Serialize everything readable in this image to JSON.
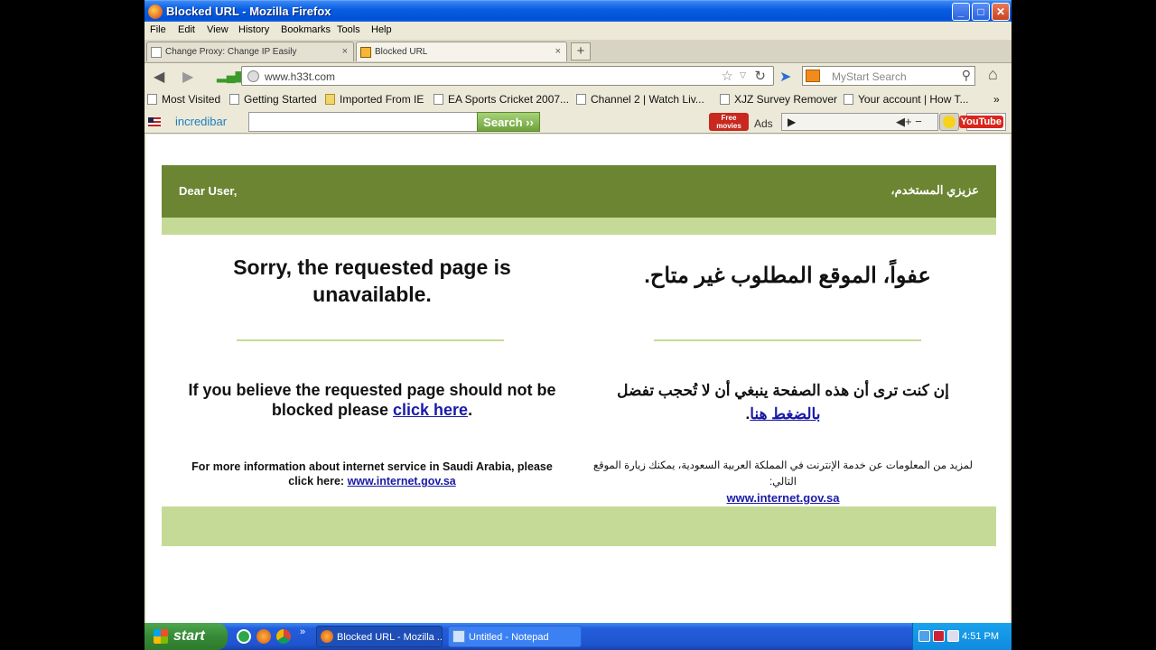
{
  "window": {
    "title": "Blocked URL - Mozilla Firefox",
    "buttons": {
      "minimize": "_",
      "maximize": "□",
      "close": "✕"
    }
  },
  "menu": [
    "File",
    "Edit",
    "View",
    "History",
    "Bookmarks",
    "Tools",
    "Help"
  ],
  "tabs": [
    {
      "label": "Change Proxy: Change IP Easily",
      "close": "×"
    },
    {
      "label": "Blocked URL",
      "close": "×"
    }
  ],
  "new_tab": "+",
  "nav": {
    "back": "◀",
    "forward": "▶",
    "url": "www.h33t.com",
    "star": "☆",
    "dropdown": "▽",
    "reload": "↻",
    "search_placeholder": "MyStart Search",
    "search_icon": "⚲",
    "home": "⌂"
  },
  "bookmarks": [
    {
      "label": "Most Visited",
      "icon": "page"
    },
    {
      "label": "Getting Started",
      "icon": "page"
    },
    {
      "label": "Imported From IE",
      "icon": "folder"
    },
    {
      "label": "EA Sports Cricket 2007...",
      "icon": "page"
    },
    {
      "label": "Channel 2 | Watch Liv...",
      "icon": "page"
    },
    {
      "label": "XJZ Survey Remover",
      "icon": "page"
    },
    {
      "label": "Your account | How T...",
      "icon": "page"
    }
  ],
  "bookmarks_more": "»",
  "incredibar": {
    "logo": "incredibar",
    "search_button": "Search ››",
    "free_movies": "Free movies",
    "ads": "Ads",
    "play": "▶",
    "youtube": "YouTube"
  },
  "page": {
    "header_en": "Dear User,",
    "header_ar": "عزيزي المستخدم،",
    "sorry_en": "Sorry, the requested page is unavailable.",
    "sorry_ar": "عفواً، الموقع المطلوب غير متاح.",
    "believe_en_prefix": "If you believe the requested page should not be blocked please",
    "believe_en_link": "click here",
    "believe_en_suffix": ".",
    "believe_ar_prefix": "إن كنت ترى أن هذه الصفحة ينبغي أن لا تُحجب تفضل",
    "believe_ar_link": "بالضغط هنا",
    "believe_ar_suffix": ".",
    "more_en": "For more information about internet service in Saudi Arabia, please click here:",
    "more_en_link": "www.internet.gov.sa",
    "more_ar": "لمزيد من المعلومات عن خدمة الإنترنت في المملكة العربية السعودية، يمكنك زيارة الموقع التالي:",
    "more_ar_link": "www.internet.gov.sa"
  },
  "taskbar": {
    "start": "start",
    "tasks": [
      {
        "label": "Blocked URL - Mozilla ...",
        "active": true
      },
      {
        "label": "Untitled - Notepad",
        "active": false
      }
    ],
    "quicklaunch_more": "»",
    "clock": "4:51 PM"
  },
  "colors": {
    "header_green": "#6b8532",
    "strip_green": "#c6da98",
    "link_blue": "#1a1aa6",
    "titlebar_blue": "#0a5ee0"
  }
}
